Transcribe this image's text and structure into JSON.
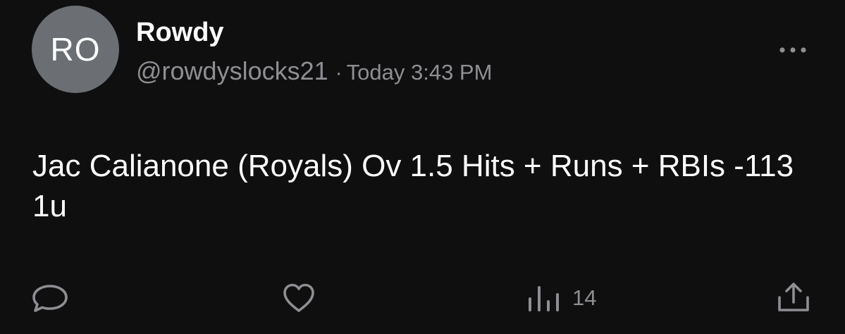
{
  "author": {
    "initials": "RO",
    "display_name": "Rowdy",
    "handle": "@rowdyslocks21",
    "separator": "·",
    "timestamp": "Today 3:43 PM",
    "avatar_color": "#6b6e72"
  },
  "post": {
    "text": "Jac Calianone (Royals) Ov 1.5 Hits + Runs + RBIs -113 1u"
  },
  "actions": {
    "reply_icon": "speech-bubble-icon",
    "like_icon": "heart-icon",
    "views_icon": "bar-chart-icon",
    "views_count": "14",
    "share_icon": "share-icon",
    "more_icon": "ellipsis-icon"
  },
  "colors": {
    "background": "#0f0f10",
    "text_primary": "#ffffff",
    "text_secondary": "#8e8e93"
  }
}
